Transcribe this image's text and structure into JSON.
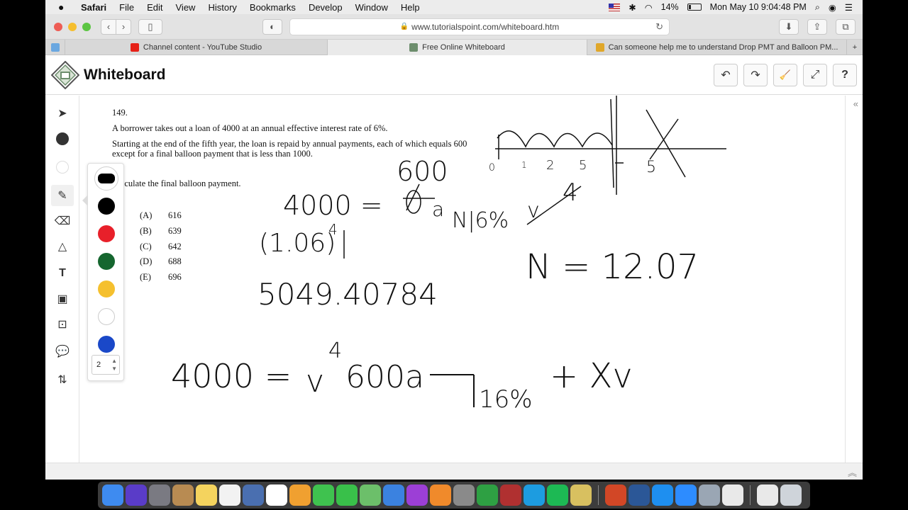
{
  "menubar": {
    "apple": "",
    "app": "Safari",
    "items": [
      "File",
      "Edit",
      "View",
      "History",
      "Bookmarks",
      "Develop",
      "Window",
      "Help"
    ],
    "battery": "14%",
    "clock": "Mon May 10  9:04:48 PM"
  },
  "browser": {
    "url": "www.tutorialspoint.com/whiteboard.htm",
    "tabs": [
      {
        "label": "Channel content - YouTube Studio",
        "favicon_color": "#e62117"
      },
      {
        "label": "Free Online Whiteboard",
        "favicon_color": "#6d8e6d"
      },
      {
        "label": "Can someone help me to understand Drop PMT and Balloon PM...",
        "favicon_color": "#e0a72a"
      }
    ],
    "new_tab": "+"
  },
  "app": {
    "title": "Whiteboard",
    "actions": [
      {
        "name": "undo",
        "icon": "↶"
      },
      {
        "name": "redo",
        "icon": "↷"
      },
      {
        "name": "clear",
        "icon": "🧹"
      },
      {
        "name": "fullscreen",
        "icon": "⤢"
      },
      {
        "name": "help",
        "icon": "?"
      }
    ]
  },
  "tools": [
    {
      "name": "select-tool",
      "icon": "cursor-icon"
    },
    {
      "name": "color-tool",
      "icon": "color-dot-icon"
    },
    {
      "name": "fill-tool",
      "icon": "fill-dot-icon"
    },
    {
      "name": "pen-tool",
      "icon": "pen-icon"
    },
    {
      "name": "eraser-tool",
      "icon": "eraser-icon"
    },
    {
      "name": "shapes-tool",
      "icon": "shapes-icon"
    },
    {
      "name": "text-tool",
      "icon": "text-icon"
    },
    {
      "name": "image-tool",
      "icon": "image-icon"
    },
    {
      "name": "image-upload-tool",
      "icon": "image-upload-icon"
    },
    {
      "name": "comment-tool",
      "icon": "comment-icon"
    },
    {
      "name": "arrange-tool",
      "icon": "arrange-icon"
    }
  ],
  "palette": {
    "colors": [
      "#000000",
      "#000000",
      "#e8202a",
      "#15662f",
      "#f5c02e",
      "#ffffff",
      "#1a48c8"
    ],
    "stroke_size": "2"
  },
  "problem": {
    "number": "149.",
    "line1": "A borrower takes out a loan of 4000 at an annual effective interest rate of 6%.",
    "line2": "Starting at the end of the fifth year, the loan is repaid by annual payments, each of which equals 600 except for a final balloon payment that is less than 1000.",
    "instruction": "Calculate the final balloon payment.",
    "choices": [
      {
        "label": "(A)",
        "value": "616"
      },
      {
        "label": "(B)",
        "value": "639"
      },
      {
        "label": "(C)",
        "value": "642"
      },
      {
        "label": "(D)",
        "value": "688"
      },
      {
        "label": "(E)",
        "value": "696"
      }
    ]
  },
  "handwriting": {
    "w1": "600",
    "w2": "4000 =",
    "w3": "a",
    "w4": "N|6%",
    "w5": "(1.06)",
    "w6": "4",
    "w7": "5049.40784",
    "w8": "N = 12.07",
    "w9": "4000 =",
    "w10": "v",
    "w11": "4",
    "w12": "600a",
    "w13": "16%",
    "w14": "+ Xv",
    "w15": "0",
    "w16": "1",
    "w17": "2",
    "w18": "5",
    "w19": "5",
    "w20": "v",
    "w21": "4"
  },
  "dock": [
    {
      "name": "finder",
      "color": "#3e8bf0"
    },
    {
      "name": "siri",
      "color": "#5a3cc8"
    },
    {
      "name": "launchpad",
      "color": "#7a7a82"
    },
    {
      "name": "contacts",
      "color": "#b88b52"
    },
    {
      "name": "notes",
      "color": "#f4d35e"
    },
    {
      "name": "reminders",
      "color": "#f2f2f2"
    },
    {
      "name": "mission-control",
      "color": "#4a6fb0"
    },
    {
      "name": "calendar",
      "color": "#ffffff"
    },
    {
      "name": "photos",
      "color": "#f0a030"
    },
    {
      "name": "messages",
      "color": "#3fc24f"
    },
    {
      "name": "facetime",
      "color": "#39c04a"
    },
    {
      "name": "maps",
      "color": "#6cbf6a"
    },
    {
      "name": "keynote",
      "color": "#3b82e0"
    },
    {
      "name": "podcasts",
      "color": "#9c3fd6"
    },
    {
      "name": "books",
      "color": "#f08a2b"
    },
    {
      "name": "system-preferences",
      "color": "#8a8a8a"
    },
    {
      "name": "app-green",
      "color": "#2ea043"
    },
    {
      "name": "dictionary",
      "color": "#b03030"
    },
    {
      "name": "skype",
      "color": "#1d9ce0"
    },
    {
      "name": "spotify",
      "color": "#1db954"
    },
    {
      "name": "archive",
      "color": "#d8c060"
    },
    {
      "name": "powerpoint",
      "color": "#d24726"
    },
    {
      "name": "word",
      "color": "#2b5797"
    },
    {
      "name": "safari",
      "color": "#1e8ff0"
    },
    {
      "name": "zoom",
      "color": "#2d8cff"
    },
    {
      "name": "preview",
      "color": "#9aa6b4"
    },
    {
      "name": "chrome",
      "color": "#e9e9e9"
    },
    {
      "name": "downloads",
      "color": "#e9e9e9"
    },
    {
      "name": "trash",
      "color": "#cfd4da"
    }
  ],
  "colors": {
    "ink": "#111111",
    "accent": "#1a48c8"
  }
}
